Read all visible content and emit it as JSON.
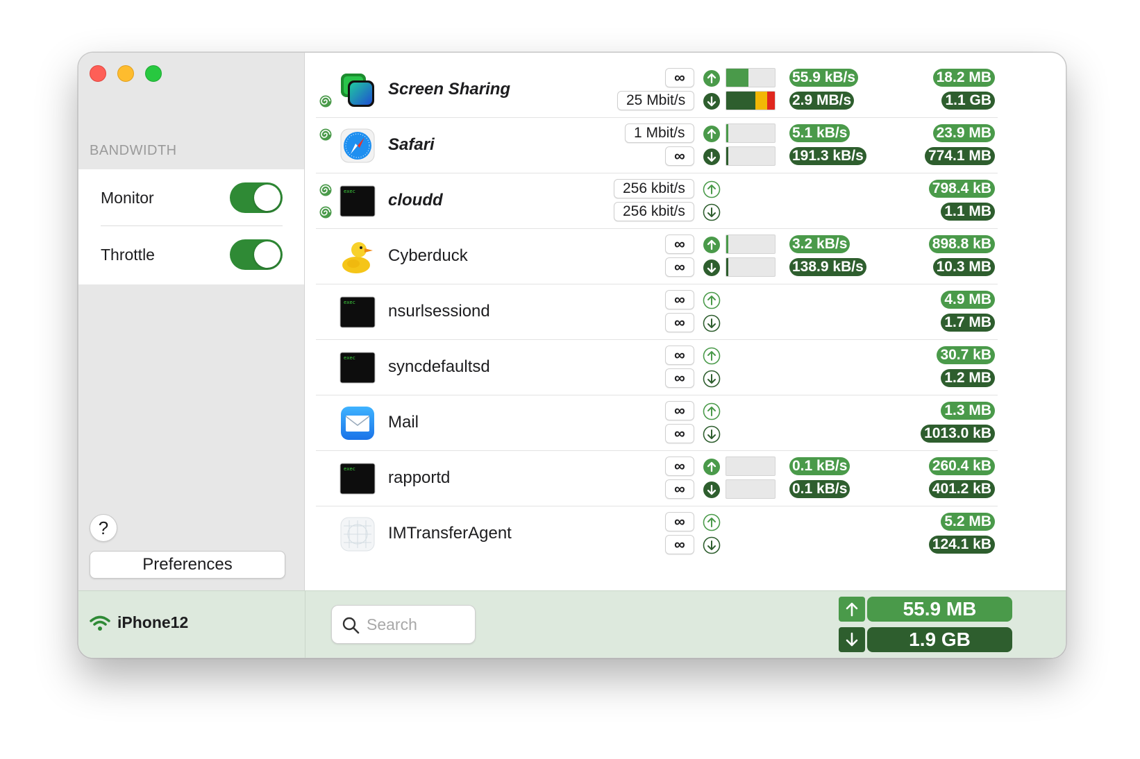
{
  "sidebar": {
    "section_title": "BANDWIDTH",
    "settings": [
      {
        "label": "Monitor",
        "enabled": true
      },
      {
        "label": "Throttle",
        "enabled": true
      }
    ],
    "help_label": "?",
    "preferences_label": "Preferences"
  },
  "footer": {
    "device_name": "iPhone12",
    "search_placeholder": "Search",
    "total_up": "55.9 MB",
    "total_down": "1.9 GB"
  },
  "colors": {
    "upload_green": "#4a9a4a",
    "download_green": "#2e5e2e",
    "toggle_on": "#2f8a35",
    "bar_yellow": "#f2b705",
    "bar_red": "#e0271e"
  },
  "apps": [
    {
      "name": "Screen Sharing",
      "icon": "screen-sharing-icon",
      "limited": true,
      "snail_up": false,
      "snail_down": true,
      "limit_up": "∞",
      "limit_down": "25 Mbit/s",
      "rate_up": "55.9 kB/s",
      "rate_down": "2.9 MB/s",
      "bar_up": 0.45,
      "bar_down": 1.0,
      "total_up": "18.2 MB",
      "total_down": "1.1 GB"
    },
    {
      "name": "Safari",
      "icon": "safari-icon",
      "limited": true,
      "snail_up": true,
      "snail_down": false,
      "limit_up": "1 Mbit/s",
      "limit_down": "∞",
      "rate_up": "5.1 kB/s",
      "rate_down": "191.3 kB/s",
      "bar_up": 0.04,
      "bar_down": 0.04,
      "total_up": "23.9 MB",
      "total_down": "774.1 MB"
    },
    {
      "name": "cloudd",
      "icon": "exec-icon",
      "limited": true,
      "snail_up": true,
      "snail_down": true,
      "limit_up": "256 kbit/s",
      "limit_down": "256 kbit/s",
      "rate_up": "",
      "rate_down": "",
      "bar_up": null,
      "bar_down": null,
      "total_up": "798.4 kB",
      "total_down": "1.1 MB"
    },
    {
      "name": "Cyberduck",
      "icon": "cyberduck-icon",
      "limited": false,
      "snail_up": false,
      "snail_down": false,
      "limit_up": "∞",
      "limit_down": "∞",
      "rate_up": "3.2 kB/s",
      "rate_down": "138.9 kB/s",
      "bar_up": 0.03,
      "bar_down": 0.03,
      "total_up": "898.8 kB",
      "total_down": "10.3 MB"
    },
    {
      "name": "nsurlsessiond",
      "icon": "exec-icon",
      "limited": false,
      "snail_up": false,
      "snail_down": false,
      "limit_up": "∞",
      "limit_down": "∞",
      "rate_up": "",
      "rate_down": "",
      "bar_up": null,
      "bar_down": null,
      "total_up": "4.9 MB",
      "total_down": "1.7 MB"
    },
    {
      "name": "syncdefaultsd",
      "icon": "exec-icon",
      "limited": false,
      "snail_up": false,
      "snail_down": false,
      "limit_up": "∞",
      "limit_down": "∞",
      "rate_up": "",
      "rate_down": "",
      "bar_up": null,
      "bar_down": null,
      "total_up": "30.7 kB",
      "total_down": "1.2 MB"
    },
    {
      "name": "Mail",
      "icon": "mail-icon",
      "limited": false,
      "snail_up": false,
      "snail_down": false,
      "limit_up": "∞",
      "limit_down": "∞",
      "rate_up": "",
      "rate_down": "",
      "bar_up": null,
      "bar_down": null,
      "total_up": "1.3 MB",
      "total_down": "1013.0 kB"
    },
    {
      "name": "rapportd",
      "icon": "exec-icon",
      "limited": false,
      "snail_up": false,
      "snail_down": false,
      "limit_up": "∞",
      "limit_down": "∞",
      "rate_up": "0.1 kB/s",
      "rate_down": "0.1 kB/s",
      "bar_up": 0.0,
      "bar_down": 0.0,
      "total_up": "260.4 kB",
      "total_down": "401.2 kB"
    },
    {
      "name": "IMTransferAgent",
      "icon": "generic-app-icon",
      "limited": false,
      "snail_up": false,
      "snail_down": false,
      "limit_up": "∞",
      "limit_down": "∞",
      "rate_up": "",
      "rate_down": "",
      "bar_up": null,
      "bar_down": null,
      "total_up": "5.2 MB",
      "total_down": "124.1 kB"
    }
  ]
}
